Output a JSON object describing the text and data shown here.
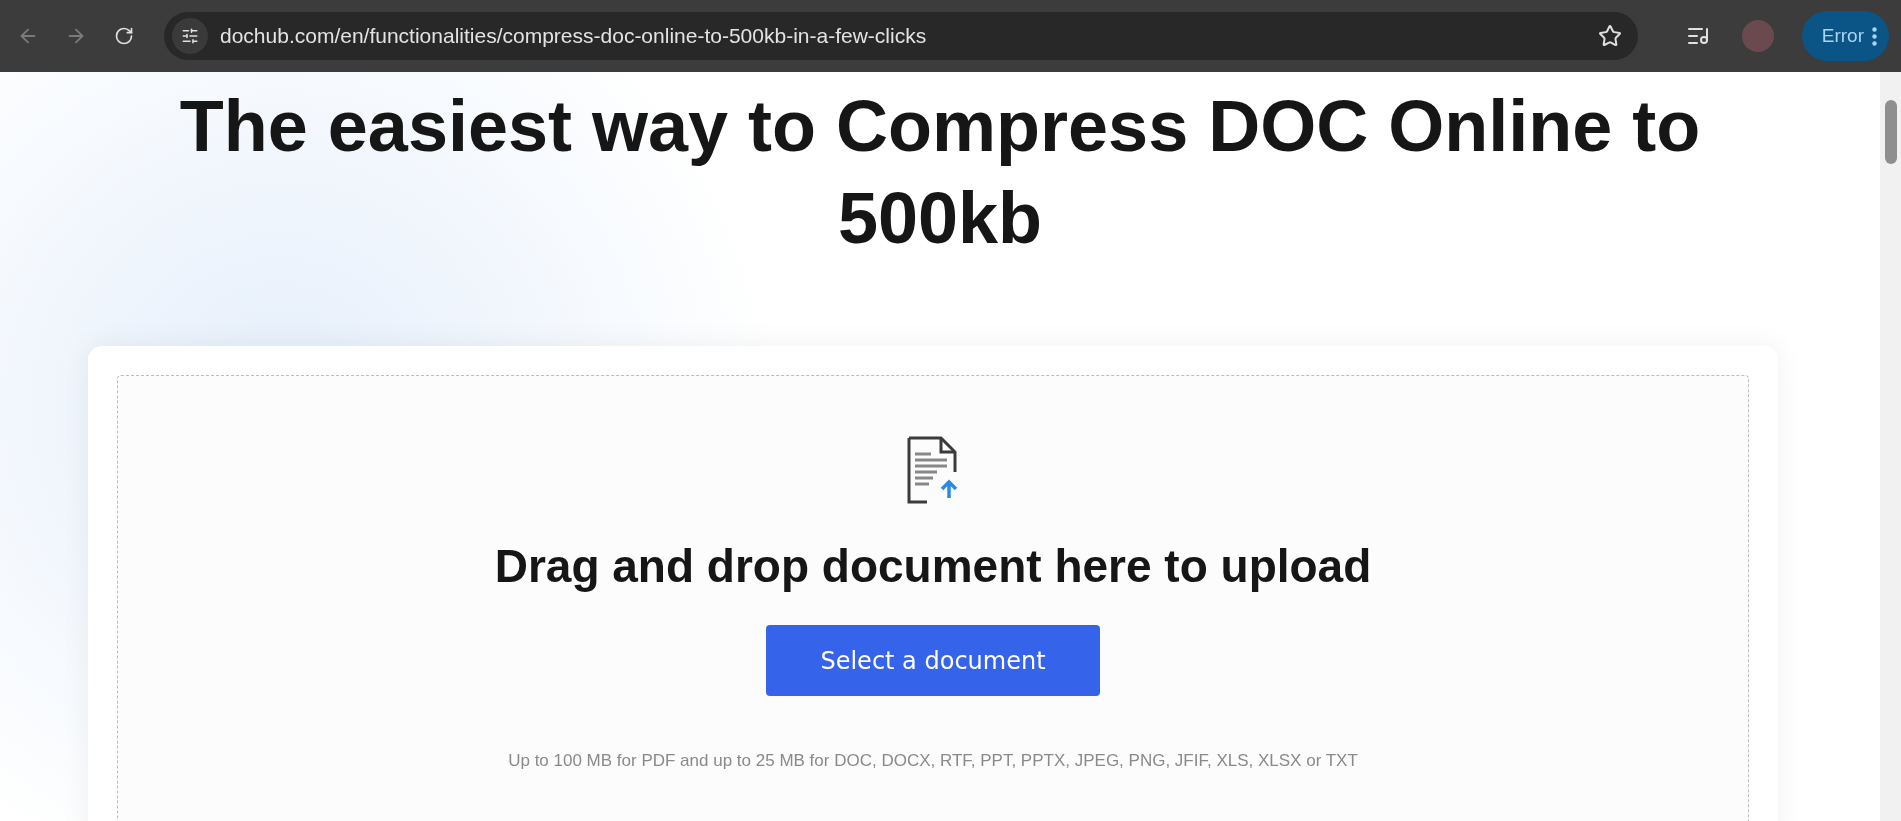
{
  "browser": {
    "url": "dochub.com/en/functionalities/compress-doc-online-to-500kb-in-a-few-clicks",
    "profile_button": "Error"
  },
  "page": {
    "title": "The easiest way to Compress DOC Online to 500kb",
    "upload": {
      "heading": "Drag and drop document here to upload",
      "button": "Select a document",
      "note": "Up to 100 MB for PDF and up to 25 MB for DOC, DOCX, RTF, PPT, PPTX, JPEG, PNG, JFIF, XLS, XLSX or TXT"
    }
  }
}
